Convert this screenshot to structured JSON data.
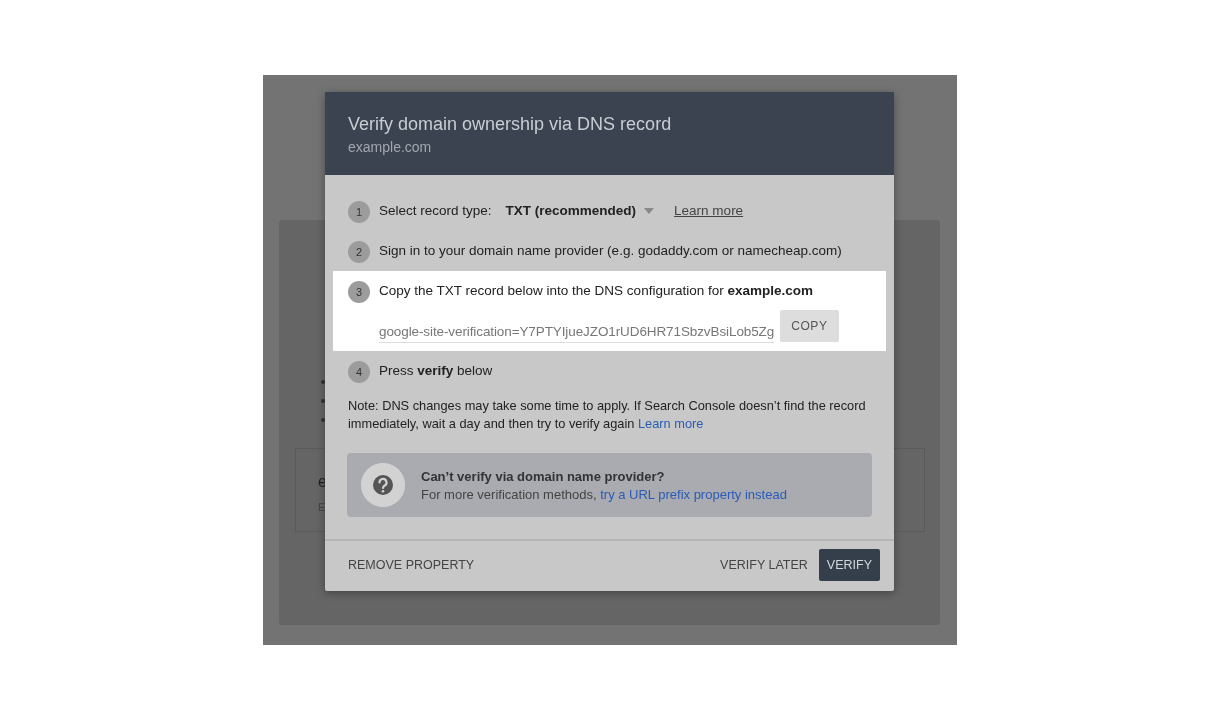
{
  "background_page": {
    "texts": [
      "e",
      "E"
    ]
  },
  "dialog": {
    "title": "Verify domain ownership via DNS record",
    "subtitle": "example.com",
    "steps": [
      {
        "number": "1",
        "kind": "select",
        "highlighted": false,
        "label": "Select record type:",
        "value": "TXT (recommended)",
        "link": "Learn more"
      },
      {
        "number": "2",
        "kind": "text",
        "highlighted": false,
        "text": "Sign in to your domain name provider (e.g. godaddy.com or namecheap.com)"
      },
      {
        "number": "3",
        "kind": "record",
        "highlighted": true,
        "text": "Copy the TXT record below into the DNS configuration for **example.com**",
        "record": "google-site-verification=Y7PTYIjueJZO1rUD6HR71SbzvBsiLob5Zg",
        "copy_button": "COPY"
      },
      {
        "number": "4",
        "kind": "text",
        "highlighted": false,
        "text": "Press **verify** below"
      }
    ],
    "note": {
      "text": "Note: DNS changes may take some time to apply. If Search Console doesn’t find the record immediately, wait a day and then try to verify again",
      "link": "Learn more"
    },
    "help": {
      "title": "Can’t verify via domain name provider?",
      "text": "For more verification methods,",
      "link": "try a URL prefix property instead"
    },
    "footer": {
      "remove": "REMOVE PROPERTY",
      "later": "VERIFY LATER",
      "verify": "VERIFY"
    }
  }
}
